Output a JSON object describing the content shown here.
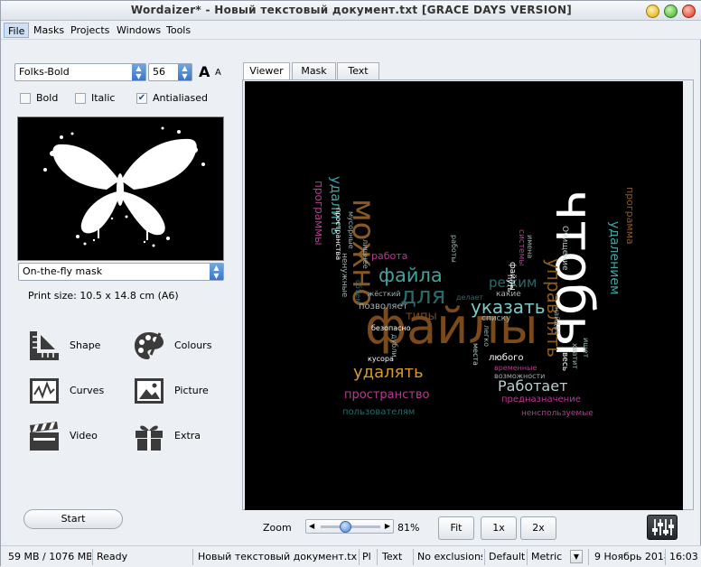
{
  "window": {
    "title": "Wordaizer* - Новый текстовый документ.txt     [GRACE DAYS VERSION]"
  },
  "menu": {
    "items": [
      "File",
      "Masks",
      "Projects",
      "Windows",
      "Tools"
    ]
  },
  "font": {
    "family": "Folks-Bold",
    "size": "56",
    "big_a": "A",
    "small_a": "A",
    "bold_label": "Bold",
    "italic_label": "Italic",
    "antialiased_label": "Antialiased",
    "bold_checked": false,
    "italic_checked": false,
    "antialiased_checked": true
  },
  "mask": {
    "selected": "On-the-fly mask"
  },
  "print_size": "Print size: 10.5 x 14.8 cm (A6)",
  "tools": {
    "shape": "Shape",
    "colours": "Colours",
    "curves": "Curves",
    "picture": "Picture",
    "video": "Video",
    "extra": "Extra"
  },
  "start_label": "Start",
  "tabs": [
    "Viewer",
    "Mask",
    "Text"
  ],
  "active_tab": "Viewer",
  "zoom": {
    "label": "Zoom",
    "value": "81%",
    "level": 0.81,
    "fit": "Fit",
    "x1": "1x",
    "x2": "2x"
  },
  "wordcloud": {
    "words": [
      "файлы",
      "чтобы",
      "можно",
      "файла",
      "для",
      "указать",
      "управлять",
      "удалять",
      "Работает",
      "пространство",
      "режим",
      "типы",
      "удалением",
      "удалить",
      "программы",
      "программа",
      "позволяет",
      "работа",
      "пользователям",
      "ненспользуемые",
      "предназначение",
      "списку",
      "любого",
      "кусора",
      "легко",
      "ненужные",
      "мусорные",
      "системы",
      "файлы",
      "весь",
      "жёсткий",
      "какие",
      "делает",
      "имена",
      "временные",
      "возможности",
      "ищет",
      "работы",
      "Очищение",
      "найдёт",
      "дубли",
      "лишнее",
      "путь",
      "безопасно",
      "хватит",
      "места",
      "объем",
      "пространства"
    ],
    "colors": [
      "#8a5a22",
      "#ffffff",
      "#3fa3a0",
      "#b83a8f",
      "#2b6a6a",
      "#7a4a1c",
      "#9fb0b0"
    ]
  },
  "status": {
    "memory": "59 MB / 1076 MB",
    "state": "Ready",
    "file": "Новый текстовый документ.txt",
    "pl": "Pl",
    "text": "Text",
    "exclusions": "No exclusions",
    "default": "Default",
    "metric": "Metric",
    "date": "9 Ноябрь 2018",
    "time": "16:03"
  }
}
